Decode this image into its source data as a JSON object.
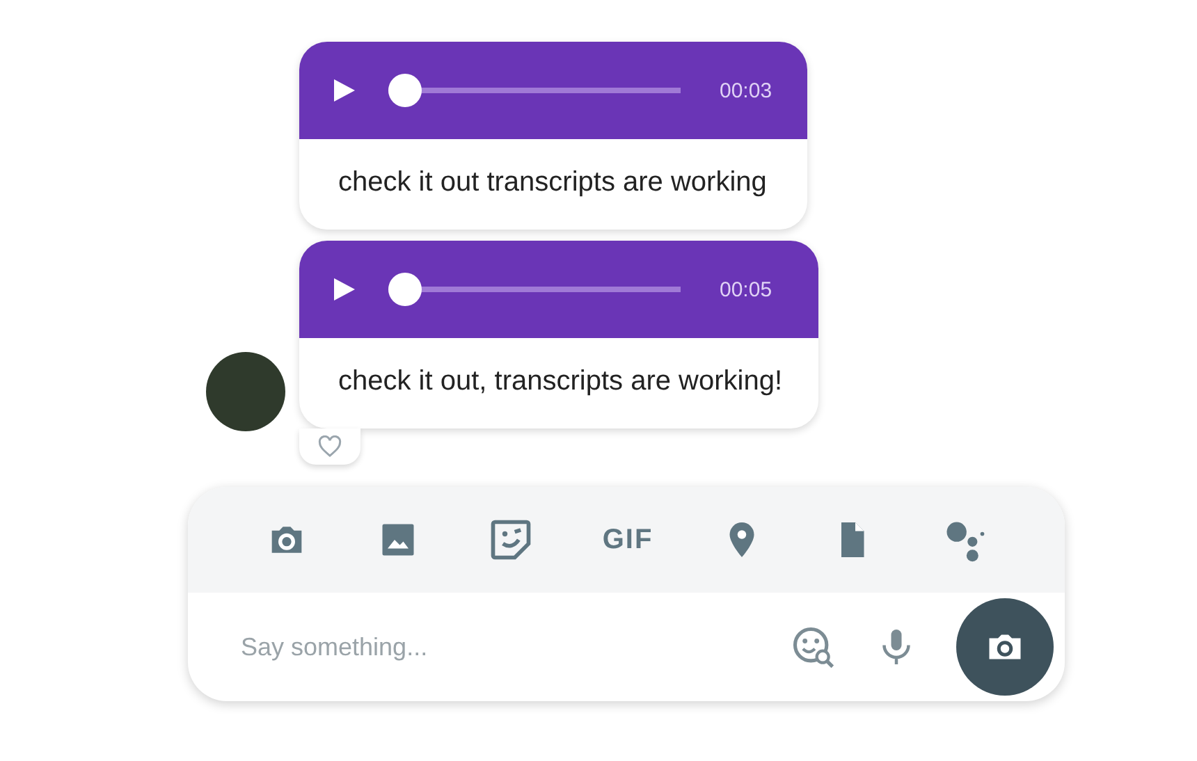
{
  "messages": [
    {
      "duration": "00:03",
      "level": 0,
      "transcript": "check it out transcripts are working",
      "avatar": false,
      "reaction": false
    },
    {
      "duration": "00:05",
      "level": 0,
      "transcript": "check it out, transcripts are working!",
      "avatar": true,
      "reaction": true
    }
  ],
  "composer": {
    "tools": [
      {
        "kind": "camera"
      },
      {
        "kind": "image"
      },
      {
        "kind": "sticker"
      },
      {
        "kind": "gif",
        "label": "GIF"
      },
      {
        "kind": "location"
      },
      {
        "kind": "file"
      },
      {
        "kind": "assistant"
      }
    ],
    "placeholder": "Say something..."
  }
}
